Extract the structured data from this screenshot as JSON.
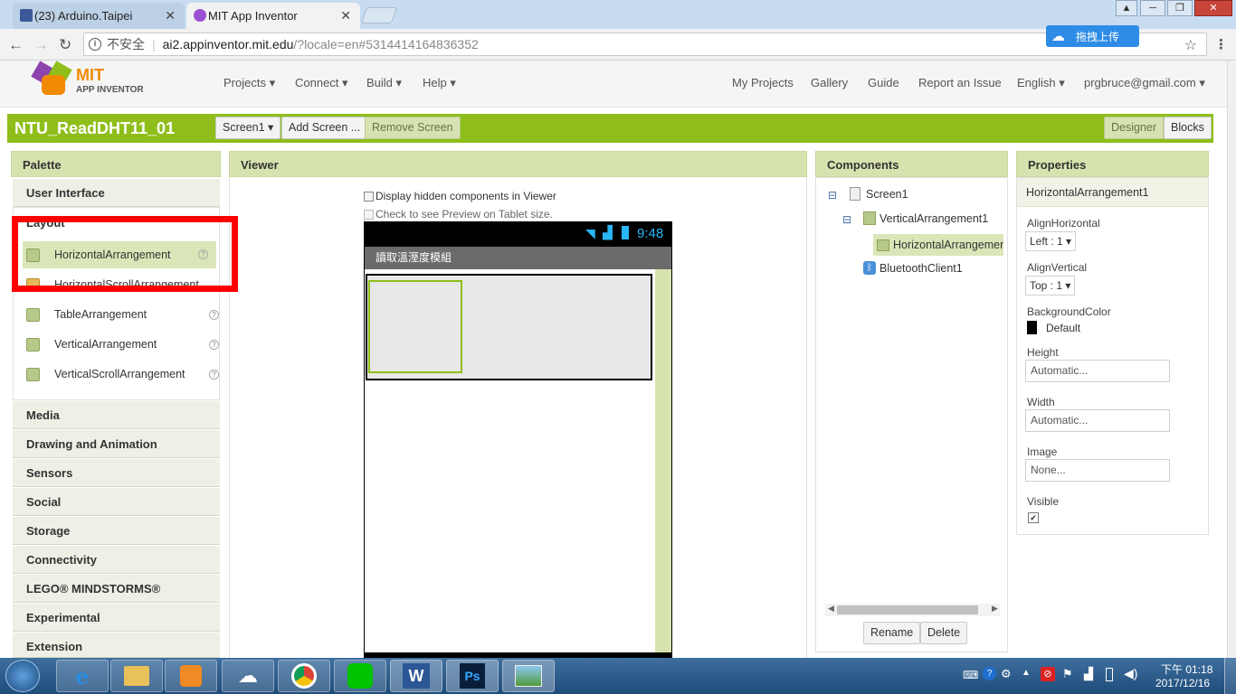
{
  "browser": {
    "tabs": [
      {
        "label": "(23) Arduino.Taipei"
      },
      {
        "label": "MIT App Inventor"
      }
    ],
    "close_glyph": "✕",
    "security_label": "不安全",
    "url_host": "ai2.appinventor.mit.edu",
    "url_rest": "/?locale=en#5314414164836352",
    "ext_label": "拖拽上传",
    "icons": [
      "back-icon",
      "forward-icon",
      "reload-icon",
      "info-icon",
      "star-icon",
      "menu-icon"
    ]
  },
  "app": {
    "logo_mit": "MIT",
    "logo_sub": "APP INVENTOR",
    "menus": [
      "Projects ▾",
      "Connect ▾",
      "Build ▾",
      "Help ▾"
    ],
    "right_menus": [
      "My Projects",
      "Gallery",
      "Guide",
      "Report an Issue",
      "English ▾",
      "prgbruce@gmail.com ▾"
    ]
  },
  "project": {
    "name": "NTU_ReadDHT11_01",
    "screen_btn": "Screen1 ▾",
    "add_screen": "Add Screen ...",
    "remove_screen": "Remove Screen",
    "designer": "Designer",
    "blocks": "Blocks"
  },
  "palette": {
    "title": "Palette",
    "user_interface": "User Interface",
    "layout_header": "Layout",
    "layout_items": [
      "HorizontalArrangement",
      "HorizontalScrollArrangement",
      "TableArrangement",
      "VerticalArrangement",
      "VerticalScrollArrangement"
    ],
    "help_glyph": "?",
    "categories": [
      "Media",
      "Drawing and Animation",
      "Sensors",
      "Social",
      "Storage",
      "Connectivity",
      "LEGO® MINDSTORMS®",
      "Experimental",
      "Extension"
    ]
  },
  "viewer": {
    "title": "Viewer",
    "chk_hidden": "Display hidden components in Viewer",
    "chk_tablet": "Check to see Preview on Tablet size.",
    "time": "9:48",
    "app_title": "讀取溫溼度模組"
  },
  "components": {
    "title": "Components",
    "tree": [
      "Screen1",
      "VerticalArrangement1",
      "HorizontalArrangement1",
      "BluetoothClient1"
    ],
    "collapse_glyph": "⊟",
    "rename": "Rename",
    "delete": "Delete"
  },
  "properties": {
    "title": "Properties",
    "selected": "HorizontalArrangement1",
    "align_h_label": "AlignHorizontal",
    "align_h_value": "Left : 1 ▾",
    "align_v_label": "AlignVertical",
    "align_v_value": "Top : 1 ▾",
    "bg_label": "BackgroundColor",
    "bg_value": "Default",
    "height_label": "Height",
    "height_value": "Automatic...",
    "width_label": "Width",
    "width_value": "Automatic...",
    "image_label": "Image",
    "image_value": "None...",
    "visible_label": "Visible",
    "visible_glyph": "✔",
    "colors": {
      "accent": "#8fbe1a",
      "header": "#d7e3ae",
      "highlight": "#ff0000"
    }
  },
  "taskbar": {
    "apps": [
      "e",
      "W",
      "Ps"
    ],
    "tray_icons": [
      "keyboard-icon",
      "help-icon",
      "gear-icon",
      "arrow-up-icon",
      "antivirus-icon",
      "flag-icon",
      "signal-icon",
      "battery-icon",
      "volume-icon"
    ],
    "time": "下午 01:18",
    "date": "2017/12/16"
  }
}
